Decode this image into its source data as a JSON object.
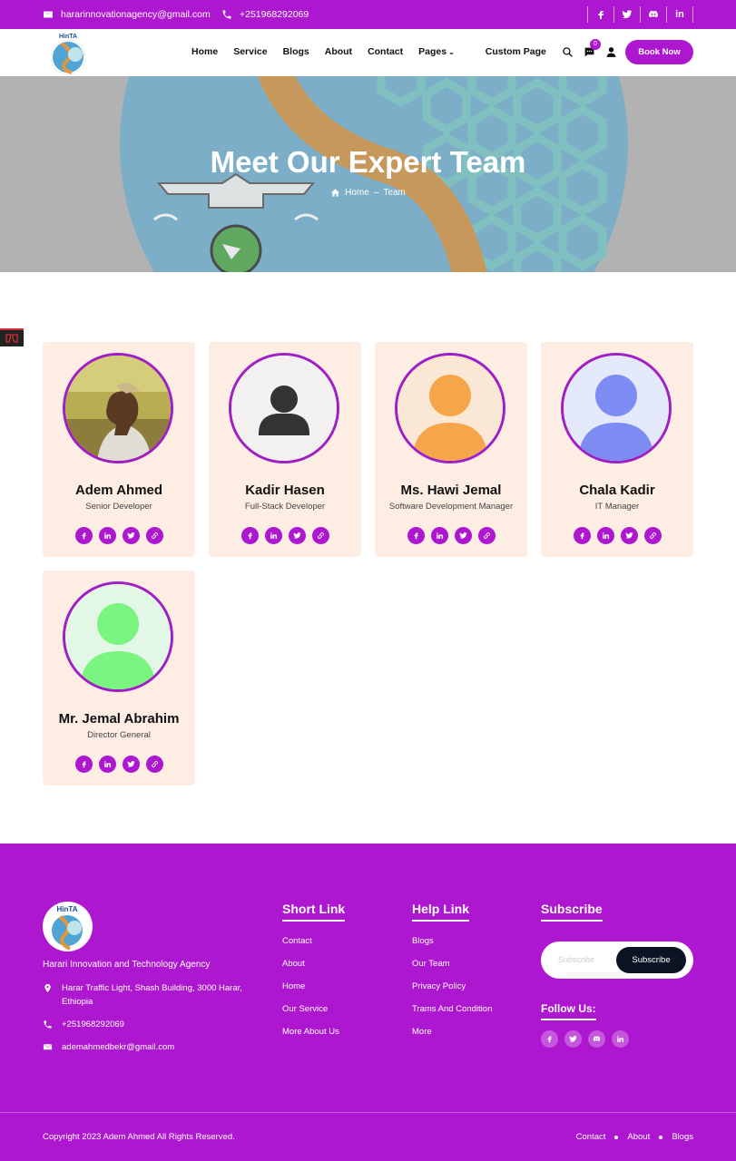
{
  "topbar": {
    "email": "hararinnovationagency@gmail.com",
    "phone": "+251968292069",
    "social_icons": [
      "facebook-icon",
      "twitter-icon",
      "discord-icon",
      "linkedin-icon"
    ],
    "linkedin_label": "in"
  },
  "navbar": {
    "logo_text": "HinTA",
    "menu": [
      "Home",
      "Service",
      "Blogs",
      "About",
      "Contact",
      "Pages",
      "Custom Page"
    ],
    "message_count": "0",
    "book_label": "Book Now"
  },
  "hero": {
    "title": "Meet Our Expert Team",
    "crumb_home": "Home",
    "crumb_sep": "–",
    "crumb_current": "Team"
  },
  "team": [
    {
      "name": "Adem Ahmed",
      "role": "Senior Developer"
    },
    {
      "name": "Kadir Hasen",
      "role": "Full-Stack Developer"
    },
    {
      "name": "Ms. Hawi Jemal",
      "role": "Software Development Manager"
    },
    {
      "name": "Chala Kadir",
      "role": "IT Manager"
    },
    {
      "name": "Mr. Jemal Abrahim",
      "role": "Director General"
    }
  ],
  "footer": {
    "org_name": "Harari Innovation and Technology Agency",
    "address": "Harar Traffic Light, Shash Building, 3000 Harar, Ethiopia",
    "phone": "+251968292069",
    "email": "ademahmedbekr@gmail.com",
    "short_link_title": "Short Link",
    "short_links": [
      "Contact",
      "About",
      "Home",
      "Our Service",
      "More About Us"
    ],
    "help_link_title": "Help Link",
    "help_links": [
      "Blogs",
      "Our Team",
      "Privacy Policy",
      "Trams And Condition",
      "More"
    ],
    "subscribe_title": "Subscribe",
    "subscribe_placeholder": "Subscribe",
    "subscribe_button": "Subscribe",
    "follow_title": "Follow Us:",
    "copyright": "Copyright 2023 Adem Ahmed All Rights Reserved.",
    "bottom_links": [
      "Contact",
      "About",
      "Blogs"
    ]
  },
  "colors": {
    "brand": "#ad17cf",
    "card_bg": "#fdede3",
    "dark_button": "#0b1322"
  }
}
